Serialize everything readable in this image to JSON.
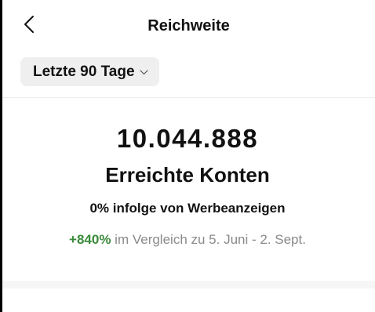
{
  "header": {
    "title": "Reichweite",
    "back_icon": "chevron-left-icon"
  },
  "filter": {
    "range_label": "Letzte 90 Tage",
    "caret_icon": "chevron-down-icon"
  },
  "metric": {
    "value": "10.044.888",
    "label": "Erreichte Konten",
    "ads_share": "0% infolge von Werbeanzeigen",
    "comparison": {
      "delta": "+840%",
      "text": " im Vergleich zu 5. Juni - 2. Sept."
    }
  },
  "colors": {
    "positive": "#3a8a3a",
    "muted_text": "#8a8a8a",
    "chip_bg": "#efefef"
  }
}
